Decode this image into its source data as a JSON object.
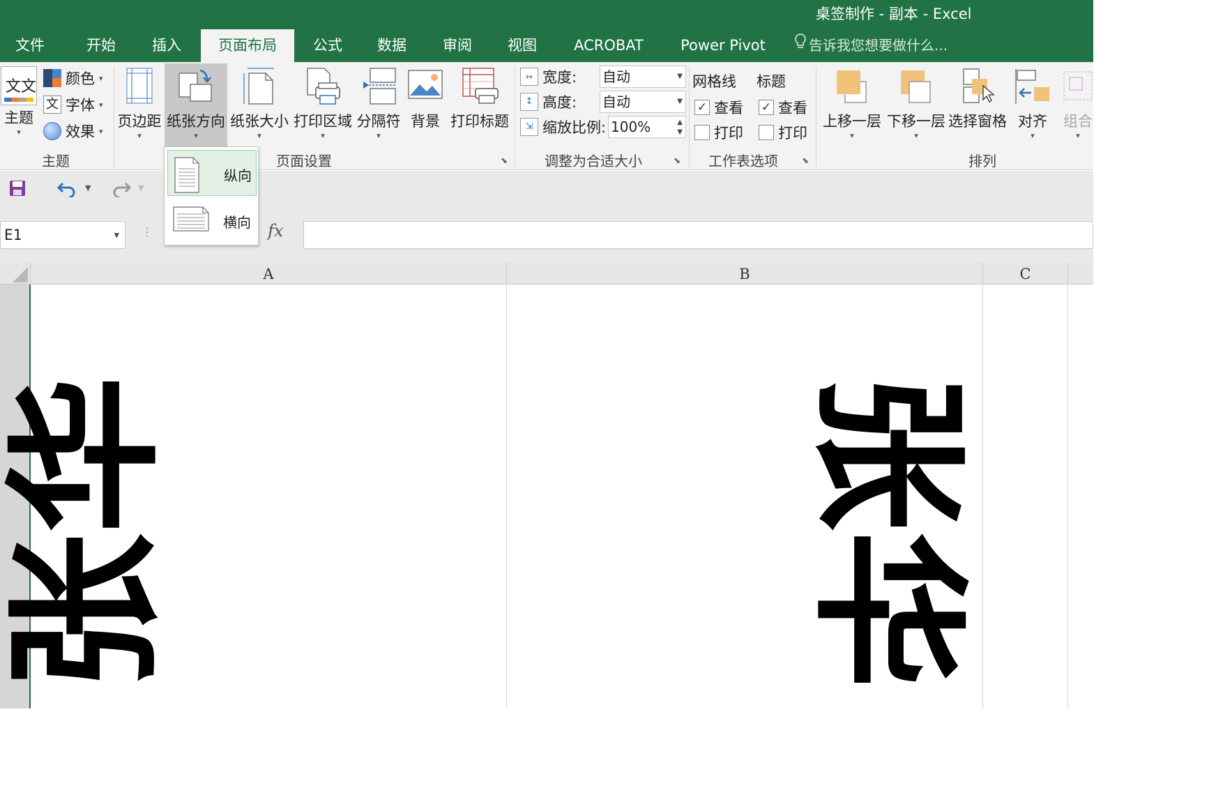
{
  "window": {
    "title": "桌签制作 - 副本 - Excel"
  },
  "tabs": [
    {
      "label": "文件"
    },
    {
      "label": "开始"
    },
    {
      "label": "插入"
    },
    {
      "label": "页面布局",
      "active": true
    },
    {
      "label": "公式"
    },
    {
      "label": "数据"
    },
    {
      "label": "审阅"
    },
    {
      "label": "视图"
    },
    {
      "label": "ACROBAT"
    },
    {
      "label": "Power Pivot"
    }
  ],
  "tell_me": "告诉我您想要做什么...",
  "ribbon": {
    "theme": {
      "theme_label": "主题",
      "colors": "颜色",
      "fonts": "字体",
      "effects": "效果",
      "group": "主题",
      "icon_text": "文文"
    },
    "page_setup": {
      "margins": "页边距",
      "orientation": "纸张方向",
      "size": "纸张大小",
      "print_area": "打印区域",
      "breaks": "分隔符",
      "background": "背景",
      "print_titles": "打印标题",
      "group": "页面设置"
    },
    "scale": {
      "width_label": "宽度:",
      "width_value": "自动",
      "height_label": "高度:",
      "height_value": "自动",
      "scale_label": "缩放比例:",
      "scale_value": "100%",
      "group": "调整为合适大小"
    },
    "sheet_options": {
      "gridlines": "网格线",
      "headings": "标题",
      "view": "查看",
      "print": "打印",
      "group": "工作表选项"
    },
    "arrange": {
      "bring_forward": "上移一层",
      "send_backward": "下移一层",
      "selection_pane": "选择窗格",
      "align": "对齐",
      "group_btn": "组合",
      "group": "排列"
    }
  },
  "orientation_menu": [
    {
      "label": "纵向",
      "selected": true
    },
    {
      "label": "横向",
      "selected": false
    }
  ],
  "name_box": "E1",
  "formula_fx": "fx",
  "columns": [
    "A",
    "B",
    "C"
  ],
  "cells": {
    "A1": "张华",
    "B1": "张华"
  },
  "colors": {
    "excel_green": "#217346"
  }
}
